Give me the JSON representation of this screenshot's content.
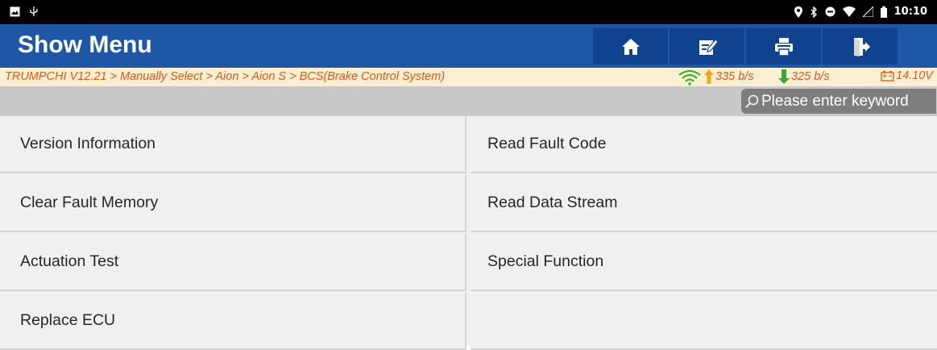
{
  "status_bar": {
    "time": "10:10"
  },
  "header": {
    "title": "Show Menu",
    "buttons": [
      {
        "name": "home-button",
        "icon": "home-icon"
      },
      {
        "name": "edit-button",
        "icon": "edit-icon"
      },
      {
        "name": "print-button",
        "icon": "print-icon"
      },
      {
        "name": "exit-button",
        "icon": "exit-icon"
      }
    ]
  },
  "breadcrumb": {
    "text": "TRUMPCHI V12.21 > Manually Select > Aion > Aion S > BCS(Brake Control System)",
    "upload_rate": "335 b/s",
    "download_rate": "325 b/s",
    "voltage": "14.10V"
  },
  "search": {
    "placeholder": "Please enter keyword"
  },
  "menu": {
    "items": [
      {
        "label": "Version Information"
      },
      {
        "label": "Read Fault Code"
      },
      {
        "label": "Clear Fault Memory"
      },
      {
        "label": "Read Data Stream"
      },
      {
        "label": "Actuation Test"
      },
      {
        "label": "Special Function"
      },
      {
        "label": "Replace ECU"
      },
      {
        "label": ""
      }
    ]
  },
  "colors": {
    "header_bg": "#1f57a7",
    "header_button_bg": "#10438f",
    "breadcrumb_text": "#e8521c",
    "breadcrumb_bg": "#fbf1d2",
    "upload_arrow": "#f0a81b",
    "download_arrow": "#3aa73a",
    "wifi": "#36b236"
  }
}
